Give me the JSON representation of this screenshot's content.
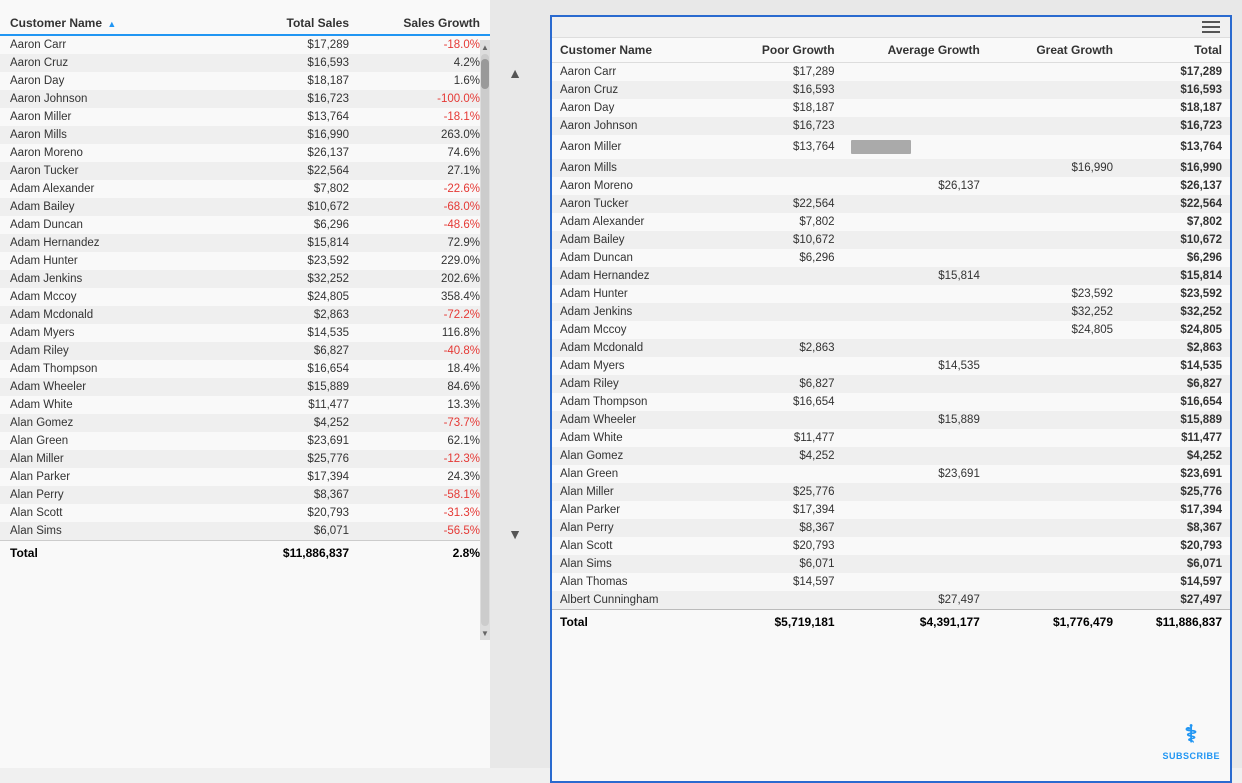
{
  "leftTable": {
    "columns": [
      "Customer Name",
      "Total Sales",
      "Sales Growth"
    ],
    "rows": [
      [
        "Aaron Carr",
        "$17,289",
        "-18.0%"
      ],
      [
        "Aaron Cruz",
        "$16,593",
        "4.2%"
      ],
      [
        "Aaron Day",
        "$18,187",
        "1.6%"
      ],
      [
        "Aaron Johnson",
        "$16,723",
        "-100.0%"
      ],
      [
        "Aaron Miller",
        "$13,764",
        "-18.1%"
      ],
      [
        "Aaron Mills",
        "$16,990",
        "263.0%"
      ],
      [
        "Aaron Moreno",
        "$26,137",
        "74.6%"
      ],
      [
        "Aaron Tucker",
        "$22,564",
        "27.1%"
      ],
      [
        "Adam Alexander",
        "$7,802",
        "-22.6%"
      ],
      [
        "Adam Bailey",
        "$10,672",
        "-68.0%"
      ],
      [
        "Adam Duncan",
        "$6,296",
        "-48.6%"
      ],
      [
        "Adam Hernandez",
        "$15,814",
        "72.9%"
      ],
      [
        "Adam Hunter",
        "$23,592",
        "229.0%"
      ],
      [
        "Adam Jenkins",
        "$32,252",
        "202.6%"
      ],
      [
        "Adam Mccoy",
        "$24,805",
        "358.4%"
      ],
      [
        "Adam Mcdonald",
        "$2,863",
        "-72.2%"
      ],
      [
        "Adam Myers",
        "$14,535",
        "116.8%"
      ],
      [
        "Adam Riley",
        "$6,827",
        "-40.8%"
      ],
      [
        "Adam Thompson",
        "$16,654",
        "18.4%"
      ],
      [
        "Adam Wheeler",
        "$15,889",
        "84.6%"
      ],
      [
        "Adam White",
        "$11,477",
        "13.3%"
      ],
      [
        "Alan Gomez",
        "$4,252",
        "-73.7%"
      ],
      [
        "Alan Green",
        "$23,691",
        "62.1%"
      ],
      [
        "Alan Miller",
        "$25,776",
        "-12.3%"
      ],
      [
        "Alan Parker",
        "$17,394",
        "24.3%"
      ],
      [
        "Alan Perry",
        "$8,367",
        "-58.1%"
      ],
      [
        "Alan Scott",
        "$20,793",
        "-31.3%"
      ],
      [
        "Alan Sims",
        "$6,071",
        "-56.5%"
      ]
    ],
    "footer": [
      "Total",
      "$11,886,837",
      "2.8%"
    ]
  },
  "rightTable": {
    "columns": [
      "Customer Name",
      "Poor Growth",
      "Average Growth",
      "Great Growth",
      "Total"
    ],
    "rows": [
      [
        "Aaron Carr",
        "$17,289",
        "",
        "",
        "$17,289"
      ],
      [
        "Aaron Cruz",
        "$16,593",
        "",
        "",
        "$16,593"
      ],
      [
        "Aaron Day",
        "$18,187",
        "",
        "",
        "$18,187"
      ],
      [
        "Aaron Johnson",
        "$16,723",
        "",
        "",
        "$16,723"
      ],
      [
        "Aaron Miller",
        "$13,764",
        "BAR",
        "",
        "$13,764"
      ],
      [
        "Aaron Mills",
        "",
        "",
        "$16,990",
        "$16,990"
      ],
      [
        "Aaron Moreno",
        "",
        "$26,137",
        "",
        "$26,137"
      ],
      [
        "Aaron Tucker",
        "$22,564",
        "",
        "",
        "$22,564"
      ],
      [
        "Adam Alexander",
        "$7,802",
        "",
        "",
        "$7,802"
      ],
      [
        "Adam Bailey",
        "$10,672",
        "",
        "",
        "$10,672"
      ],
      [
        "Adam Duncan",
        "$6,296",
        "",
        "",
        "$6,296"
      ],
      [
        "Adam Hernandez",
        "",
        "$15,814",
        "",
        "$15,814"
      ],
      [
        "Adam Hunter",
        "",
        "",
        "$23,592",
        "$23,592"
      ],
      [
        "Adam Jenkins",
        "",
        "",
        "$32,252",
        "$32,252"
      ],
      [
        "Adam Mccoy",
        "",
        "",
        "$24,805",
        "$24,805"
      ],
      [
        "Adam Mcdonald",
        "$2,863",
        "",
        "",
        "$2,863"
      ],
      [
        "Adam Myers",
        "",
        "$14,535",
        "",
        "$14,535"
      ],
      [
        "Adam Riley",
        "$6,827",
        "",
        "",
        "$6,827"
      ],
      [
        "Adam Thompson",
        "$16,654",
        "",
        "",
        "$16,654"
      ],
      [
        "Adam Wheeler",
        "",
        "$15,889",
        "",
        "$15,889"
      ],
      [
        "Adam White",
        "$11,477",
        "",
        "",
        "$11,477"
      ],
      [
        "Alan Gomez",
        "$4,252",
        "",
        "",
        "$4,252"
      ],
      [
        "Alan Green",
        "",
        "$23,691",
        "",
        "$23,691"
      ],
      [
        "Alan Miller",
        "$25,776",
        "",
        "",
        "$25,776"
      ],
      [
        "Alan Parker",
        "$17,394",
        "",
        "",
        "$17,394"
      ],
      [
        "Alan Perry",
        "$8,367",
        "",
        "",
        "$8,367"
      ],
      [
        "Alan Scott",
        "$20,793",
        "",
        "",
        "$20,793"
      ],
      [
        "Alan Sims",
        "$6,071",
        "",
        "",
        "$6,071"
      ],
      [
        "Alan Thomas",
        "$14,597",
        "",
        "",
        "$14,597"
      ],
      [
        "Albert Cunningham",
        "",
        "$27,497",
        "",
        "$27,497"
      ]
    ],
    "footer": [
      "Total",
      "$5,719,181",
      "$4,391,177",
      "$1,776,479",
      "$11,886,837"
    ]
  },
  "subscribe": {
    "label": "SUBSCRIBE"
  }
}
